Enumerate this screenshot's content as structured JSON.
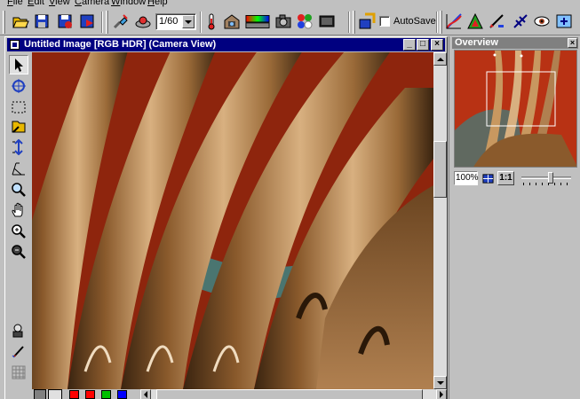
{
  "menubar": {
    "items": [
      {
        "label": "File"
      },
      {
        "label": "Edit"
      },
      {
        "label": "View"
      },
      {
        "label": "Camera"
      },
      {
        "label": "Window"
      },
      {
        "label": "Help"
      }
    ]
  },
  "toolbar": {
    "shutter_speed": "1/60",
    "autosave_label": "AutoSave",
    "autosave_checked": false,
    "icons": [
      "open-folder-icon",
      "save-icon",
      "save-settings-icon",
      "save-red-icon",
      "camera-connect-icon",
      "capture-icon",
      "thermometer-icon",
      "camera-house-icon",
      "gradient-icon",
      "camera-icon",
      "rgb-channels-icon",
      "preview-icon",
      "settings-icon",
      "curves-icon",
      "color-balance-icon",
      "sharpen-icon",
      "compare-icon",
      "eye-icon",
      "info-icon"
    ]
  },
  "document": {
    "title": "Untitled Image [RGB HDR] (Camera View)",
    "image_subject": "fork tines close-up",
    "vscroll_position": 0.3,
    "hscroll_position": 0.05
  },
  "tools": [
    "pointer-icon",
    "crosshair-target-icon",
    "marquee-select-icon",
    "magic-wand-icon",
    "vertical-resize-icon",
    "perspective-icon",
    "zoom-icon",
    "hand-pan-icon",
    "zoom-in-icon",
    "zoom-out-icon",
    "layers-icon",
    "pen-icon",
    "grid-icon"
  ],
  "statusbar": {
    "swatch_colors": [
      "#ff0000",
      "#ff0000",
      "#00c000",
      "#0000ff"
    ]
  },
  "overview": {
    "title": "Overview",
    "zoom": "100%",
    "one_to_one_label": "1:1",
    "zoom_slider_position": 0.55
  },
  "colors": {
    "titlebar_active": "#000080",
    "panel_title": "#808080",
    "face": "#c0c0c0"
  }
}
